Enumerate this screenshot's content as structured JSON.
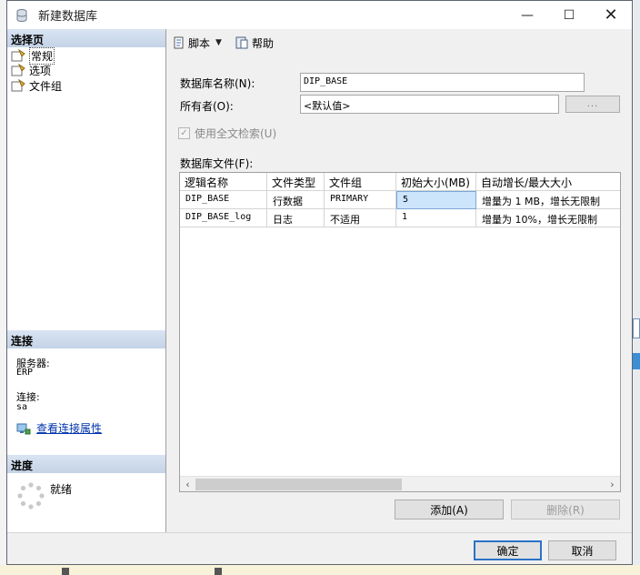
{
  "window": {
    "title": "新建数据库",
    "min_glyph": "—",
    "max_glyph": "☐",
    "close_glyph": "✕"
  },
  "left_pane": {
    "select_page_header": "选择页",
    "pages": [
      {
        "label": "常规"
      },
      {
        "label": "选项"
      },
      {
        "label": "文件组"
      }
    ],
    "connection_header": "连接",
    "server_label": "服务器:",
    "server_value": "ERP",
    "connection_label": "连接:",
    "connection_value": "sa",
    "view_connection_props": "查看连接属性",
    "progress_header": "进度",
    "progress_status": "就绪"
  },
  "toolbar": {
    "script_label": "脚本",
    "help_label": "帮助"
  },
  "form": {
    "db_name_label": "数据库名称(N):",
    "db_name_value": "DIP_BASE",
    "owner_label": "所有者(O):",
    "owner_value": "<默认值>",
    "browse_label": "...",
    "fulltext_label": "使用全文检索(U)",
    "fulltext_checked": true,
    "files_label": "数据库文件(F):"
  },
  "db_files": {
    "columns": [
      "逻辑名称",
      "文件类型",
      "文件组",
      "初始大小(MB)",
      "自动增长/最大大小"
    ],
    "rows": [
      {
        "name": "DIP_BASE",
        "type": "行数据",
        "filegroup": "PRIMARY",
        "size": "5",
        "growth": "增量为 1 MB，增长无限制"
      },
      {
        "name": "DIP_BASE_log",
        "type": "日志",
        "filegroup": "不适用",
        "size": "1",
        "growth": "增量为 10%，增长无限制"
      }
    ]
  },
  "buttons": {
    "add": "添加(A)",
    "remove": "删除(R)",
    "ok": "确定",
    "cancel": "取消"
  }
}
